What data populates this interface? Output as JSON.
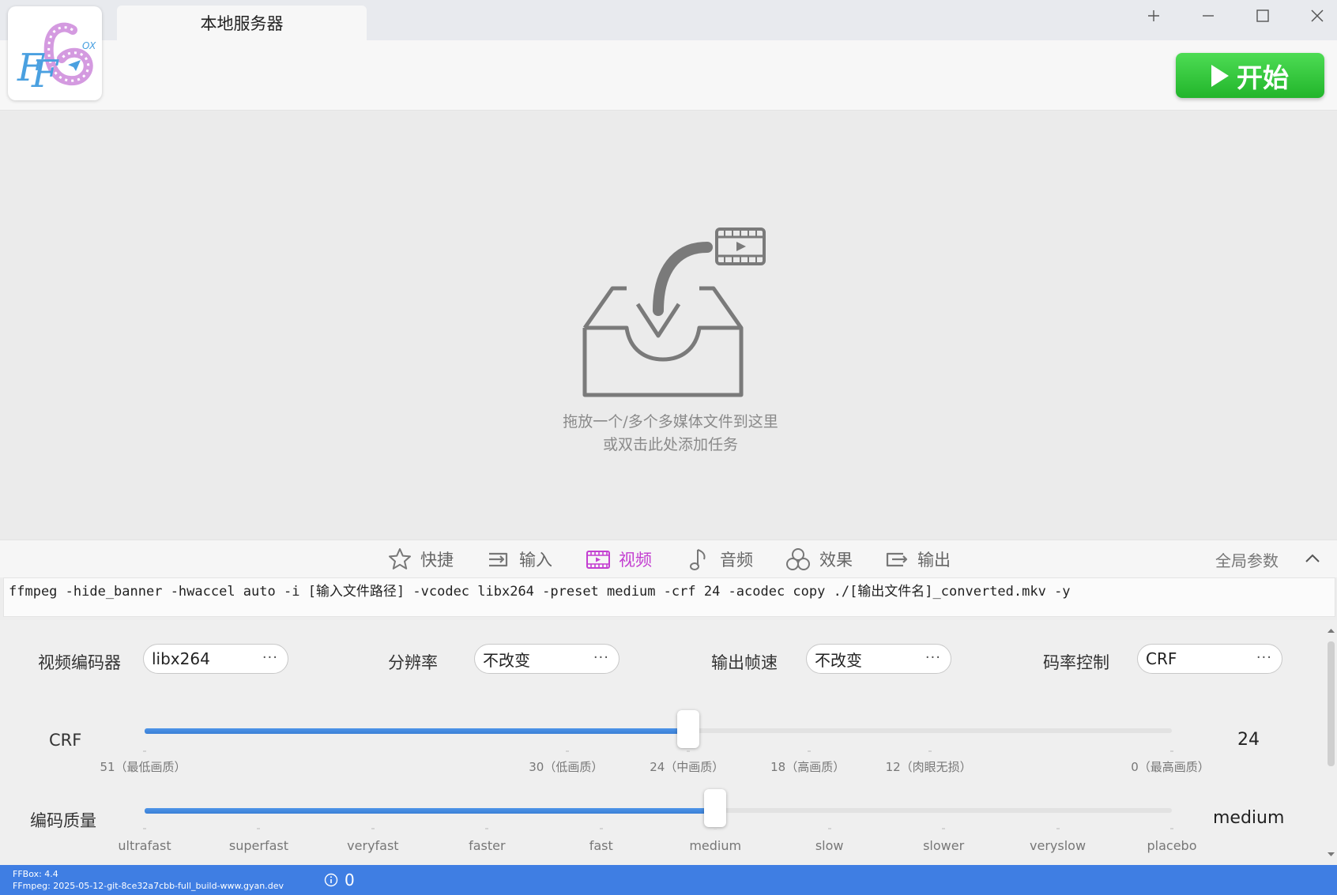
{
  "window": {
    "tab_title": "本地服务器"
  },
  "toolbar": {
    "start_label": "开始"
  },
  "drop_area": {
    "line1": "拖放一个/多个多媒体文件到这里",
    "line2": "或双击此处添加任务"
  },
  "panel_tabs": [
    {
      "label": "快捷",
      "icon": "star-icon"
    },
    {
      "label": "输入",
      "icon": "input-icon"
    },
    {
      "label": "视频",
      "icon": "video-icon"
    },
    {
      "label": "音频",
      "icon": "audio-icon"
    },
    {
      "label": "效果",
      "icon": "effects-icon"
    },
    {
      "label": "输出",
      "icon": "output-icon"
    }
  ],
  "active_tab": "视频",
  "global_params_label": "全局参数",
  "command": "ffmpeg -hide_banner -hwaccel auto -i [输入文件路径] -vcodec libx264 -preset medium -crf 24 -acodec copy ./[输出文件名]_converted.mkv -y",
  "params": {
    "video_encoder": {
      "label": "视频编码器",
      "value": "libx264"
    },
    "resolution": {
      "label": "分辨率",
      "value": "不改变"
    },
    "frame_rate": {
      "label": "输出帧速",
      "value": "不改变"
    },
    "rate_control": {
      "label": "码率控制",
      "value": "CRF"
    },
    "combo_more": "···"
  },
  "crf_slider": {
    "label": "CRF",
    "value": "24",
    "min": 51,
    "max": 0,
    "current": 24,
    "ticks": [
      {
        "text": "51（最低画质）",
        "value": 51
      },
      {
        "text": "30（低画质）",
        "value": 30
      },
      {
        "text": "24（中画质）",
        "value": 24
      },
      {
        "text": "18（高画质）",
        "value": 18
      },
      {
        "text": "12（肉眼无损）",
        "value": 12
      },
      {
        "text": "0（最高画质）",
        "value": 0
      }
    ]
  },
  "preset_slider": {
    "label": "编码质量",
    "value": "medium",
    "options": [
      "ultrafast",
      "superfast",
      "veryfast",
      "faster",
      "fast",
      "medium",
      "slow",
      "slower",
      "veryslow",
      "placebo"
    ],
    "current_index": 5
  },
  "status": {
    "ffbox_version": "FFBox: 4.4",
    "ffmpeg_version": "FFmpeg: 2025-05-12-git-8ce32a7cbb-full_build-www.gyan.dev",
    "info_count": "0"
  },
  "colors": {
    "accent": "#c33fd1",
    "start_button": "#2fc237",
    "status_bar": "#3f7ee3",
    "slider_fill": "#3a7fd6"
  }
}
